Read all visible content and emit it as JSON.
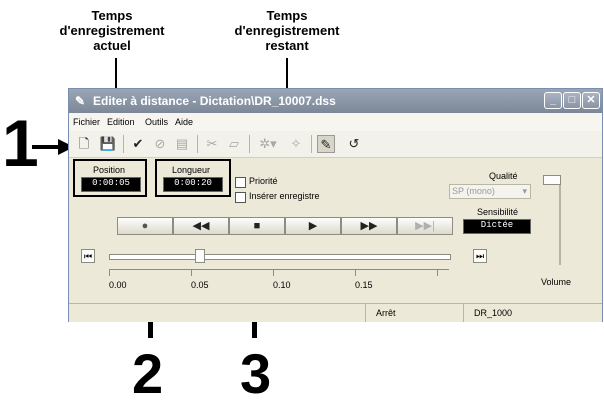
{
  "callouts": {
    "current_time_label": [
      "Temps",
      "d'enregistrement",
      "actuel"
    ],
    "remaining_time_label": [
      "Temps",
      "d'enregistrement",
      "restant"
    ]
  },
  "numbers": {
    "one": "1",
    "two": "2",
    "three": "3"
  },
  "window": {
    "title": "Editer à distance - Dictation\\DR_10007.dss",
    "menu": [
      "Fichier",
      "Edition",
      "Outils",
      "Aide"
    ]
  },
  "position": {
    "label": "Position",
    "value": "0:00:05"
  },
  "longueur": {
    "label": "Longueur",
    "value": "0:00:20"
  },
  "options": {
    "priority": "Priorité",
    "insert": "Insérer enregistre"
  },
  "quality": {
    "label": "Qualité",
    "value": "SP (mono)"
  },
  "sensitivity": {
    "label": "Sensibilité",
    "value": "Dictée"
  },
  "volume_label": "Volume",
  "timeline_ticks": [
    "0.00",
    "0.05",
    "0.10",
    "0.15"
  ],
  "status": {
    "state": "Arrêt",
    "file": "DR_1000"
  },
  "transport": {
    "record": "●",
    "rewind": "◀◀",
    "stop": "■",
    "play": "▶",
    "ffwd": "▶▶",
    "end": "▶▶|"
  }
}
